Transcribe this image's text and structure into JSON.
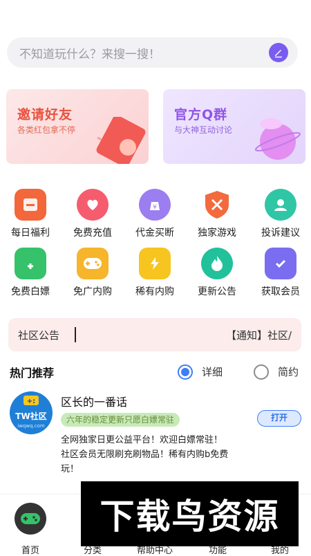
{
  "search": {
    "placeholder": "不知道玩什么？来搜一搜！",
    "icon": "pencil-icon"
  },
  "banners": [
    {
      "title": "邀请好友",
      "subtitle": "各类红包拿不停",
      "title_color": "#e8523f",
      "sub_color": "#e26a58"
    },
    {
      "title": "官方Q群",
      "subtitle": "与大神互动讨论",
      "title_color": "#8e55e6",
      "sub_color": "#8e63d9"
    }
  ],
  "grid": [
    {
      "label": "每日福利",
      "icon": "document-icon",
      "color": "#f2673b"
    },
    {
      "label": "免费充值",
      "icon": "heart-bag-icon",
      "color": "#f55d6e"
    },
    {
      "label": "代金买断",
      "icon": "coin-bag-icon",
      "color": "#9b7ef0"
    },
    {
      "label": "独家游戏",
      "icon": "shield-sword-icon",
      "color": "#f26a3d"
    },
    {
      "label": "投诉建议",
      "icon": "user-icon",
      "color": "#2fc6a6"
    },
    {
      "label": "免费白嫖",
      "icon": "phone-plus-icon",
      "color": "#35c26a"
    },
    {
      "label": "免广内购",
      "icon": "gamepad-icon",
      "color": "#f6b52a"
    },
    {
      "label": "稀有内购",
      "icon": "crown-bolt-icon",
      "color": "#f7c51f"
    },
    {
      "label": "更新公告",
      "icon": "flame-icon",
      "color": "#21c19b"
    },
    {
      "label": "获取会员",
      "icon": "check-card-icon",
      "color": "#7a6df0"
    }
  ],
  "notice": {
    "label": "社区公告",
    "text": "【通知】社区/"
  },
  "section": {
    "title": "热门推荐",
    "option_detail": "详细",
    "option_simple": "简约",
    "selected": "详细"
  },
  "card": {
    "title": "区长的一番话",
    "tag": "六年的稳定更新只愿白嫖常驻",
    "open_label": "打开",
    "desc_line1": "全网独家日更公益平台！欢迎白嫖常驻！",
    "desc_line2": "社区会员无限刷充刷物品！稀有内购b免费",
    "desc_line3": "玩！",
    "logo_text": "TW社区",
    "logo_sub": "iwqwq.com"
  },
  "bottom_nav": [
    {
      "label": "首页",
      "icon": "gamepad-icon"
    },
    {
      "label": "分类",
      "icon": "grid-icon"
    },
    {
      "label": "帮助中心",
      "icon": "help-icon"
    },
    {
      "label": "功能",
      "icon": "apps-icon"
    },
    {
      "label": "我的",
      "icon": "user-icon"
    }
  ],
  "watermark": "下载鸟资源"
}
